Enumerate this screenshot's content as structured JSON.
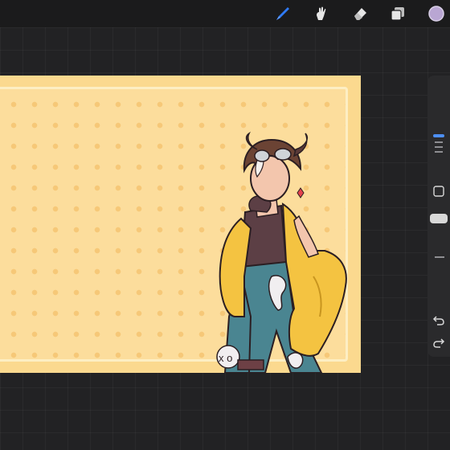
{
  "app": {
    "accent": "#2f7bf5",
    "color_chip": "#b9a6d3"
  },
  "toolbar": {
    "tools": [
      {
        "name": "brush-icon",
        "active": true
      },
      {
        "name": "smudge-icon",
        "active": false
      },
      {
        "name": "eraser-icon",
        "active": false
      },
      {
        "name": "layers-icon",
        "active": false
      },
      {
        "name": "color-swatch",
        "active": false
      }
    ]
  },
  "sidebar": {
    "controls": [
      "brush-size-slider",
      "modify-button",
      "opacity-slider",
      "undo-icon",
      "redo-icon"
    ]
  }
}
